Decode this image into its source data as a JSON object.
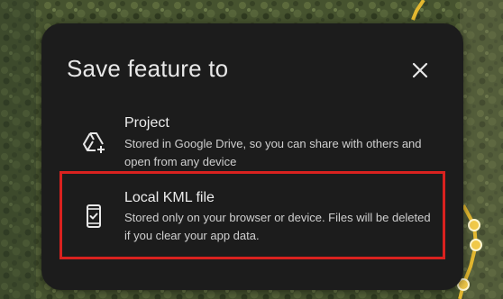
{
  "dialog": {
    "title": "Save feature to",
    "close_icon": "close-icon",
    "options": [
      {
        "icon": "add-to-drive-icon",
        "title": "Project",
        "description": "Stored in Google Drive, so you can share with others and open from any device"
      },
      {
        "icon": "phone-check-icon",
        "title": "Local KML file",
        "description": "Stored only on your browser or device. Files will be deleted if you clear your app data."
      }
    ]
  },
  "annotation": {
    "highlight_color": "#d9221f"
  },
  "colors": {
    "dialog_background": "#1c1c1c",
    "title_text": "#e8e8e8",
    "path_line": "#e3b830"
  }
}
